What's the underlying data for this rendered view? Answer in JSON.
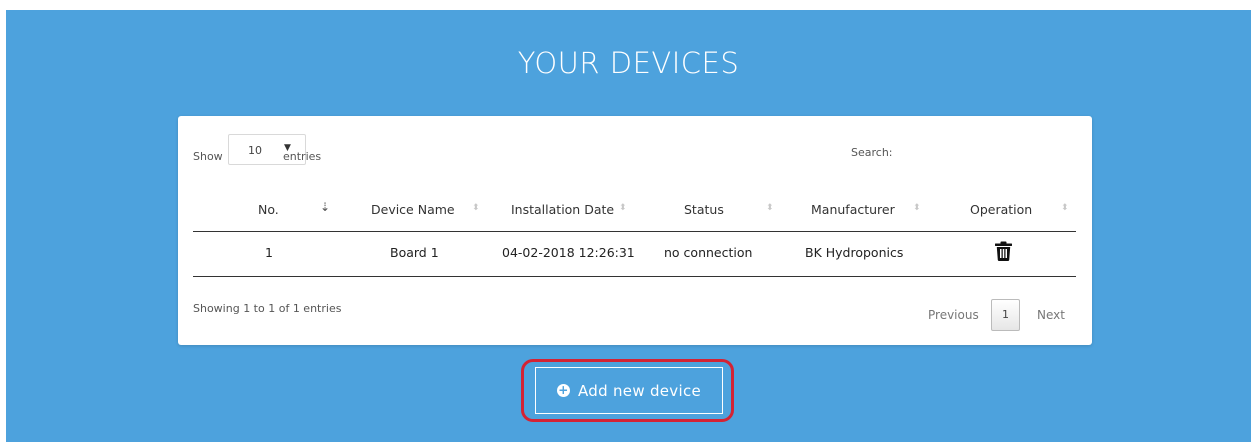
{
  "page": {
    "title": "YOUR DEVICES"
  },
  "table": {
    "length": {
      "show_label": "Show",
      "value": "10",
      "entries_label": "entries"
    },
    "search": {
      "label": "Search:",
      "value": ""
    },
    "columns": [
      "No.",
      "Device Name",
      "Installation Date",
      "Status",
      "Manufacturer",
      "Operation"
    ],
    "rows": [
      {
        "no": "1",
        "device_name": "Board 1",
        "installation_date": "04-02-2018 12:26:31",
        "status": "no connection",
        "manufacturer": "BK Hydroponics",
        "operation_icon": "trash-icon"
      }
    ],
    "info": "Showing 1 to 1 of 1 entries",
    "pagination": {
      "previous": "Previous",
      "page": "1",
      "next": "Next"
    }
  },
  "actions": {
    "add_device_label": "Add new device",
    "add_device_icon": "plus-circle-icon"
  },
  "colors": {
    "background": "#4da2dd",
    "highlight": "#d42334",
    "card": "#ffffff"
  }
}
